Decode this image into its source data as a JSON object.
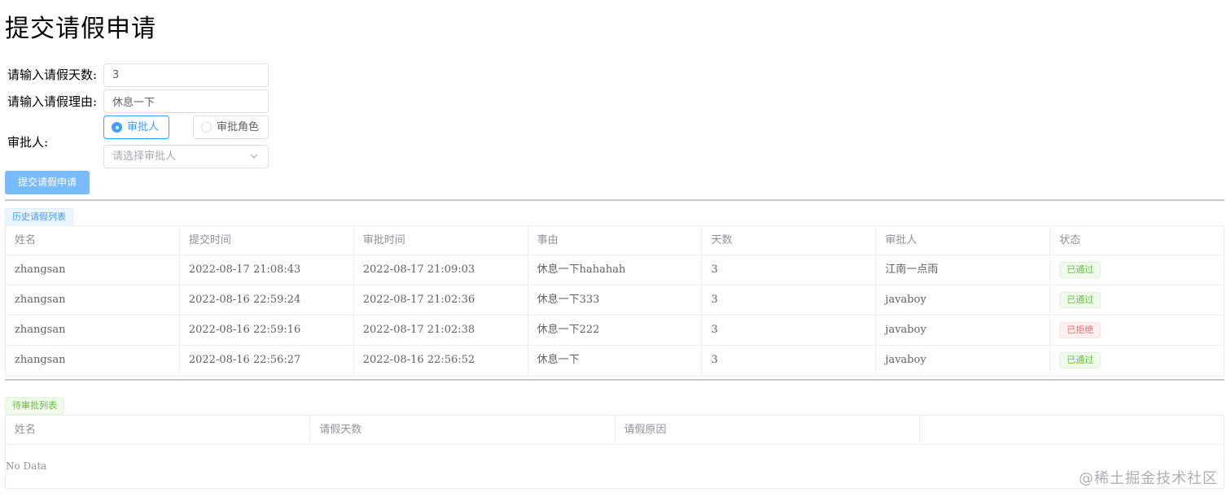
{
  "page": {
    "title": "提交请假申请"
  },
  "form": {
    "days_label": "请输入请假天数:",
    "days_value": "3",
    "reason_label": "请输入请假理由:",
    "reason_value": "休息一下",
    "approver_label": "审批人:",
    "radio_options": [
      {
        "label": "审批人",
        "checked": true
      },
      {
        "label": "审批角色",
        "checked": false
      }
    ],
    "select_placeholder": "请选择审批人",
    "submit_label": "提交请假申请"
  },
  "history": {
    "tag_label": "历史请假列表",
    "columns": [
      "姓名",
      "提交时间",
      "审批时间",
      "事由",
      "天数",
      "审批人",
      "状态"
    ],
    "rows": [
      {
        "name": "zhangsan",
        "submit_time": "2022-08-17 21:08:43",
        "approve_time": "2022-08-17 21:09:03",
        "reason": "休息一下hahahah",
        "days": "3",
        "approver": "江南一点雨",
        "status": "已通过",
        "status_type": "pass"
      },
      {
        "name": "zhangsan",
        "submit_time": "2022-08-16 22:59:24",
        "approve_time": "2022-08-17 21:02:36",
        "reason": "休息一下333",
        "days": "3",
        "approver": "javaboy",
        "status": "已通过",
        "status_type": "pass"
      },
      {
        "name": "zhangsan",
        "submit_time": "2022-08-16 22:59:16",
        "approve_time": "2022-08-17 21:02:38",
        "reason": "休息一下222",
        "days": "3",
        "approver": "javaboy",
        "status": "已拒绝",
        "status_type": "reject"
      },
      {
        "name": "zhangsan",
        "submit_time": "2022-08-16 22:56:27",
        "approve_time": "2022-08-16 22:56:52",
        "reason": "休息一下",
        "days": "3",
        "approver": "javaboy",
        "status": "已通过",
        "status_type": "pass"
      }
    ]
  },
  "pending": {
    "tag_label": "待审批列表",
    "columns": [
      "姓名",
      "请假天数",
      "请假原因",
      ""
    ],
    "empty_text": "No Data"
  },
  "watermark": "@稀土掘金技术社区",
  "colors": {
    "primary": "#409eff",
    "primary_light": "#79bbff",
    "success": "#67c23a",
    "danger": "#f56c6c"
  },
  "icons": {
    "select_arrow": "chevron-down-icon"
  }
}
